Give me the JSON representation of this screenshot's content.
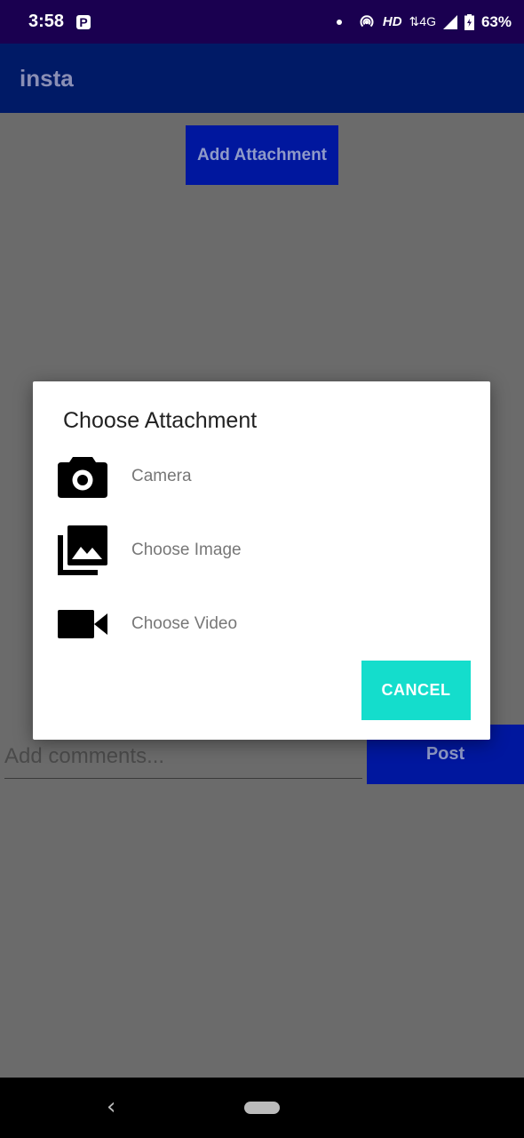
{
  "status_bar": {
    "time": "3:58",
    "p_badge": "P",
    "hd_label": "HD",
    "network_label": "4G",
    "battery": "63%"
  },
  "app_bar": {
    "title": "insta"
  },
  "main": {
    "add_attachment_label": "Add Attachment",
    "comments_placeholder": "Add comments...",
    "post_label": "Post"
  },
  "dialog": {
    "title": "Choose Attachment",
    "options": [
      {
        "label": "Camera",
        "icon": "camera-icon"
      },
      {
        "label": "Choose Image",
        "icon": "image-library-icon"
      },
      {
        "label": "Choose Video",
        "icon": "video-camera-icon"
      }
    ],
    "cancel_label": "CANCEL"
  },
  "colors": {
    "status_bar": "#1a0050",
    "app_bar": "#001a66",
    "primary_button": "#00179e",
    "cancel_button": "#14ddcc",
    "scrim": "#6b6b6b"
  }
}
